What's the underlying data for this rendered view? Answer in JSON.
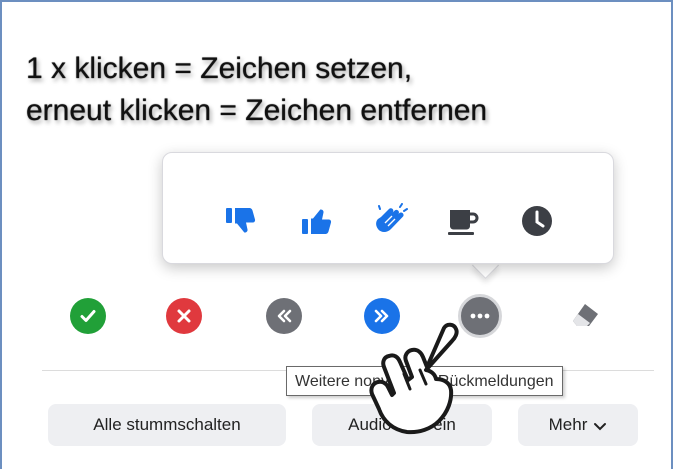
{
  "caption": {
    "line1": "1 x klicken = Zeichen setzen,",
    "line2": "erneut klicken = Zeichen entfernen"
  },
  "feedback_popup": {
    "icons": [
      "thumbs-down-icon",
      "thumbs-up-icon",
      "clapping-hands-icon",
      "coffee-cup-icon",
      "clock-icon"
    ]
  },
  "toolbar": {
    "icons": [
      "yes-check-icon",
      "no-x-icon",
      "slower-icon",
      "faster-icon",
      "more-feedback-icon",
      "eraser-icon"
    ],
    "colors": {
      "green": "#21a038",
      "red": "#e0393e",
      "gray": "#6e7076",
      "blue": "#1a73e8"
    }
  },
  "tooltip": {
    "text": "Weitere nonverbale Rückmeldungen"
  },
  "buttons": {
    "mute_all": "Alle stummschalten",
    "audio_all_on": "Audio aller ein",
    "more": "Mehr"
  }
}
